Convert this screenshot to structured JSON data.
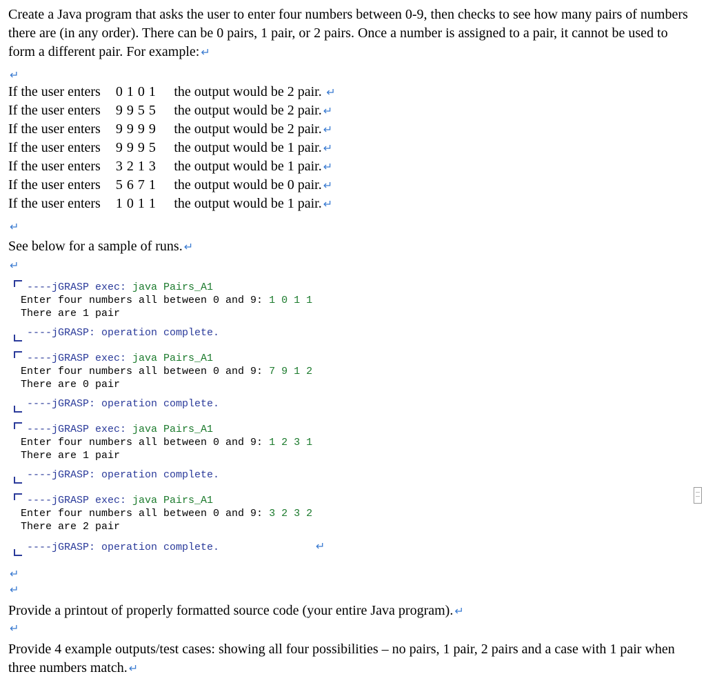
{
  "intro": "Create a Java program that asks the user to enter four numbers between 0-9, then checks to see how many pairs of numbers there are (in any order). There can be 0 pairs, 1 pair, or 2 pairs. Once a number is assigned to a pair, it cannot be used to form a different pair. For example:",
  "pilcrow": "↵",
  "examples": {
    "lead": "If the user enters",
    "rows": [
      {
        "nums": "0 1 0 1",
        "out": "the output would be 2 pair.",
        "trail": " ↵"
      },
      {
        "nums": "9 9 5 5",
        "out": "the output would be 2 pair.",
        "trail": "↵"
      },
      {
        "nums": "9 9 9 9",
        "out": "the output would be 2 pair.",
        "trail": "↵"
      },
      {
        "nums": "9 9 9 5",
        "out": "the output would be 1 pair.",
        "trail": "↵"
      },
      {
        "nums": "3 2 1 3",
        "out": "the output would be 1 pair.",
        "trail": "↵"
      },
      {
        "nums": "5 6 7 1",
        "out": "the output would be 0 pair.",
        "trail": "↵"
      },
      {
        "nums": "1 0 1 1",
        "out": "the output would be 1 pair.",
        "trail": "↵"
      }
    ]
  },
  "see_below": "See below for a sample of runs.",
  "console": {
    "exec_prefix": " ----jGRASP exec: ",
    "exec_cmd": "java Pairs_A1",
    "prompt": "Enter four numbers all between 0 and 9: ",
    "result_prefix": "There are ",
    "result_suffix": " pair",
    "complete": " ----jGRASP: operation complete.",
    "runs": [
      {
        "input": "1 0 1 1",
        "pairs": "1"
      },
      {
        "input": "7 9 1 2",
        "pairs": "0"
      },
      {
        "input": "1 2 3 1",
        "pairs": "1"
      },
      {
        "input": "3 2 3 2",
        "pairs": "2"
      }
    ]
  },
  "foot1": "Provide a printout of properly formatted source code (your entire Java program).",
  "foot2": "Provide 4 example outputs/test cases: showing all four possibilities – no pairs, 1 pair, 2 pairs and a case with 1 pair when three numbers match."
}
